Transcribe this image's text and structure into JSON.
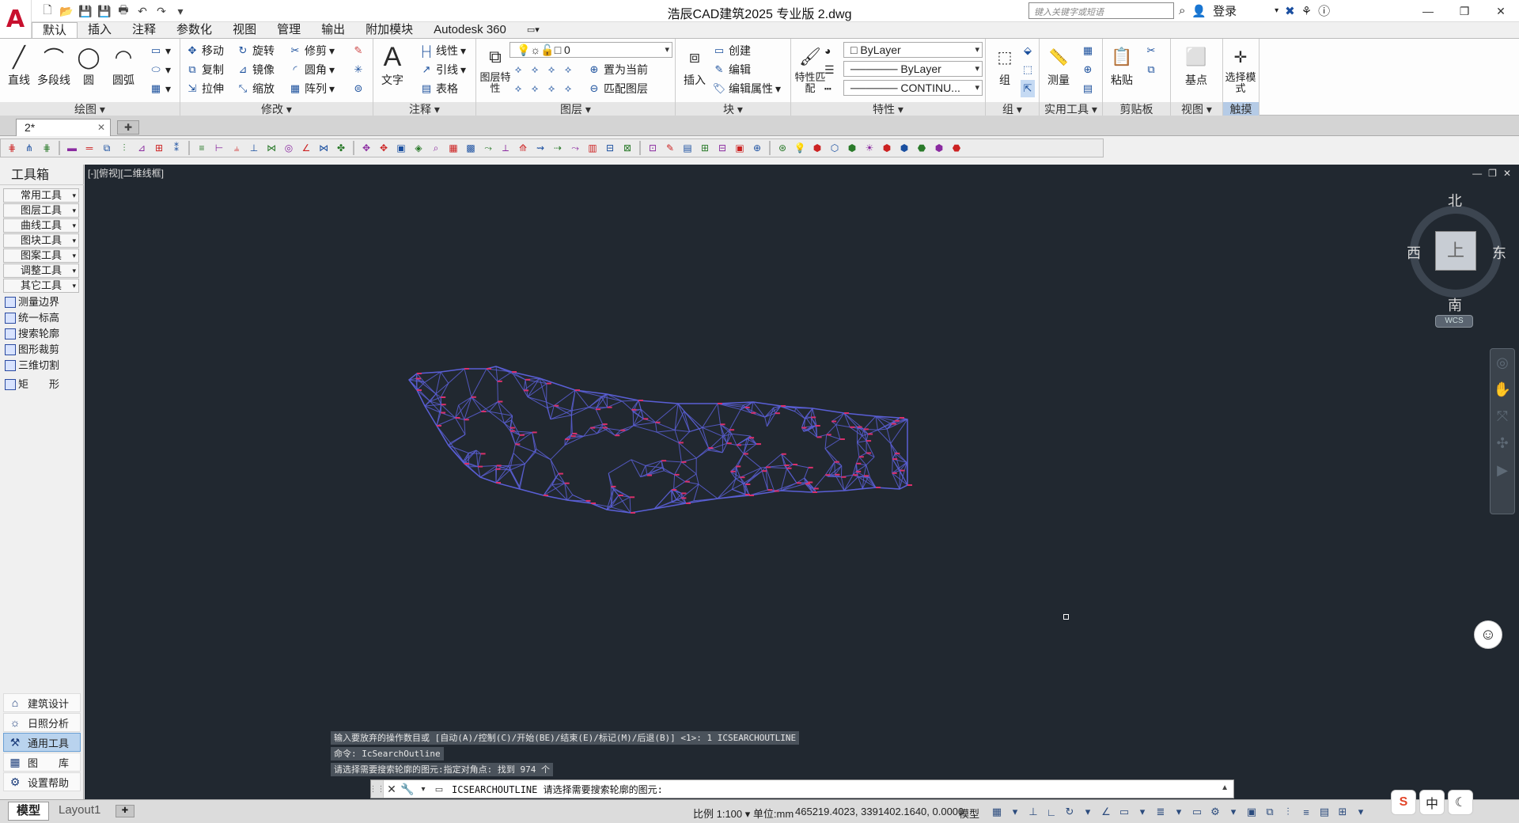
{
  "app": {
    "title": "浩辰CAD建筑2025 专业版    2.dwg",
    "logo": "A",
    "search_placeholder": "键入关键字或短语",
    "login_label": "登录"
  },
  "ribbon_tabs": [
    "默认",
    "插入",
    "注释",
    "参数化",
    "视图",
    "管理",
    "输出",
    "附加模块",
    "Autodesk 360"
  ],
  "panels": {
    "draw": {
      "title": "绘图",
      "line": "直线",
      "polyline": "多段线",
      "circle": "圆",
      "arc": "圆弧"
    },
    "modify": {
      "title": "修改",
      "move": "移动",
      "rotate": "旋转",
      "trim": "修剪",
      "copy": "复制",
      "mirror": "镜像",
      "fillet": "圆角",
      "stretch": "拉伸",
      "scale": "缩放",
      "array": "阵列"
    },
    "annotation": {
      "title": "注释",
      "text": "文字",
      "linear": "线性",
      "leader": "引线",
      "table": "表格"
    },
    "layers": {
      "title": "图层",
      "layer_props": "图层特性",
      "current_layer": "0",
      "set_current": "置为当前",
      "match_layer": "匹配图层"
    },
    "block": {
      "title": "块",
      "insert": "插入",
      "create": "创建",
      "edit": "编辑",
      "edit_attr": "编辑属性"
    },
    "properties": {
      "title": "特性",
      "match": "特性匹配",
      "color": "ByLayer",
      "lineweight": "ByLayer",
      "linetype": "CONTINU..."
    },
    "groups": {
      "title": "组",
      "group": "组"
    },
    "utilities": {
      "title": "实用工具",
      "measure": "测量"
    },
    "clipboard": {
      "title": "剪贴板",
      "paste": "粘贴"
    },
    "view": {
      "title": "视图",
      "base": "基点"
    },
    "touch": {
      "title": "触摸",
      "select": "选择模式"
    }
  },
  "doc_tab": {
    "name": "2*"
  },
  "toolbox": {
    "title": "工具箱",
    "categories": [
      "常用工具",
      "图层工具",
      "曲线工具",
      "图块工具",
      "图案工具",
      "调整工具",
      "其它工具"
    ],
    "items": [
      "测量边界",
      "统一标高",
      "搜索轮廓",
      "图形裁剪",
      "三维切割",
      "矩　　形"
    ],
    "bottom": [
      "建筑设计",
      "日照分析",
      "通用工具",
      "图　　库",
      "设置帮助"
    ]
  },
  "viewport": {
    "label": "[-][俯视][二维线框]",
    "compass": {
      "north": "北",
      "south": "南",
      "east": "东",
      "west": "西",
      "top": "上"
    },
    "wcs": "WCS"
  },
  "command": {
    "history": [
      "输入要放弃的操作数目或 [自动(A)/控制(C)/开始(BE)/结束(E)/标记(M)/后退(B)] <1>: 1 ICSEARCHOUTLINE",
      "命令: IcSearchOutline",
      "请选择需要搜索轮廓的图元:指定对角点: 找到 974 个"
    ],
    "prompt_cmd": "ICSEARCHOUTLINE",
    "prompt_text": "请选择需要搜索轮廓的图元:"
  },
  "status": {
    "model_tab": "模型",
    "layout_tab": "Layout1",
    "scale": "比例 1:100 ▾ 单位:mm",
    "coords": "465219.4023, 3391402.1640, 0.0000",
    "space": "模型"
  },
  "ime": {
    "lang": "中"
  },
  "colors": {
    "canvas": "#212830",
    "mesh_line": "#5a5fd6",
    "mesh_node": "#d9306a",
    "logo_red": "#c8102e"
  }
}
